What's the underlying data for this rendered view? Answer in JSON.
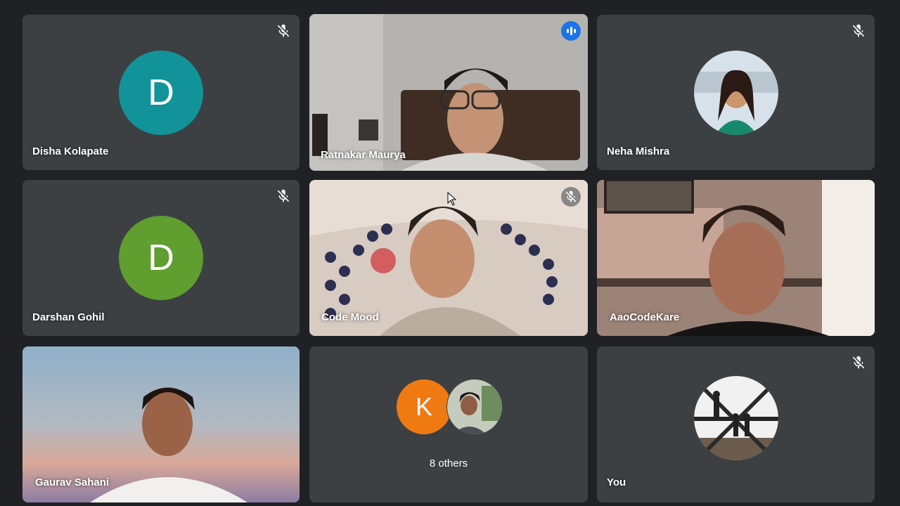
{
  "participants": [
    {
      "name": "Disha Kolapate",
      "initial": "D",
      "avatar_color": "#12939a",
      "muted": true
    },
    {
      "name": "Ratnakar Maurya",
      "speaking": true,
      "muted": false
    },
    {
      "name": "Neha Mishra",
      "muted": true
    },
    {
      "name": "Darshan Gohil",
      "initial": "D",
      "avatar_color": "#5f9e2f",
      "muted": true
    },
    {
      "name": "Code Mood",
      "muted": true
    },
    {
      "name": "AaoCodeKare",
      "muted": false
    },
    {
      "name": "Gaurav Sahani",
      "muted": false
    },
    {
      "others_label": "8 others",
      "initial": "K",
      "avatar_color": "#f07a12"
    },
    {
      "name": "You",
      "muted": true
    }
  ],
  "icons": {
    "muted": "mic-off-icon",
    "speaking": "audio-wave-icon"
  }
}
